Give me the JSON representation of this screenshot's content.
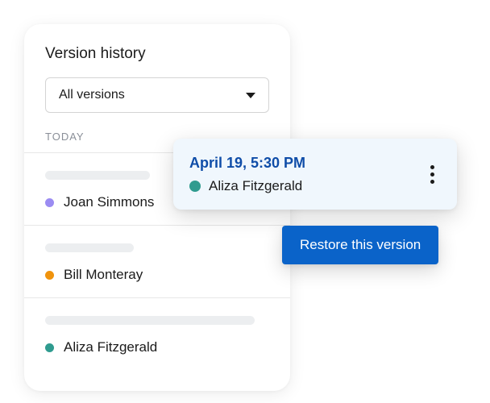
{
  "panel": {
    "title": "Version history",
    "dropdown_label": "All versions",
    "section_label": "TODAY",
    "versions": [
      {
        "author": "Joan Simmons",
        "color": "#9b8cf2"
      },
      {
        "author": "Bill Monteray",
        "color": "#f0930d"
      },
      {
        "author": "Aliza Fitzgerald",
        "color": "#2f9b8f"
      }
    ]
  },
  "popover": {
    "timestamp": "April 19, 5:30 PM",
    "author": "Aliza Fitzgerald",
    "color": "#2f9b8f"
  },
  "restore_label": "Restore this version"
}
